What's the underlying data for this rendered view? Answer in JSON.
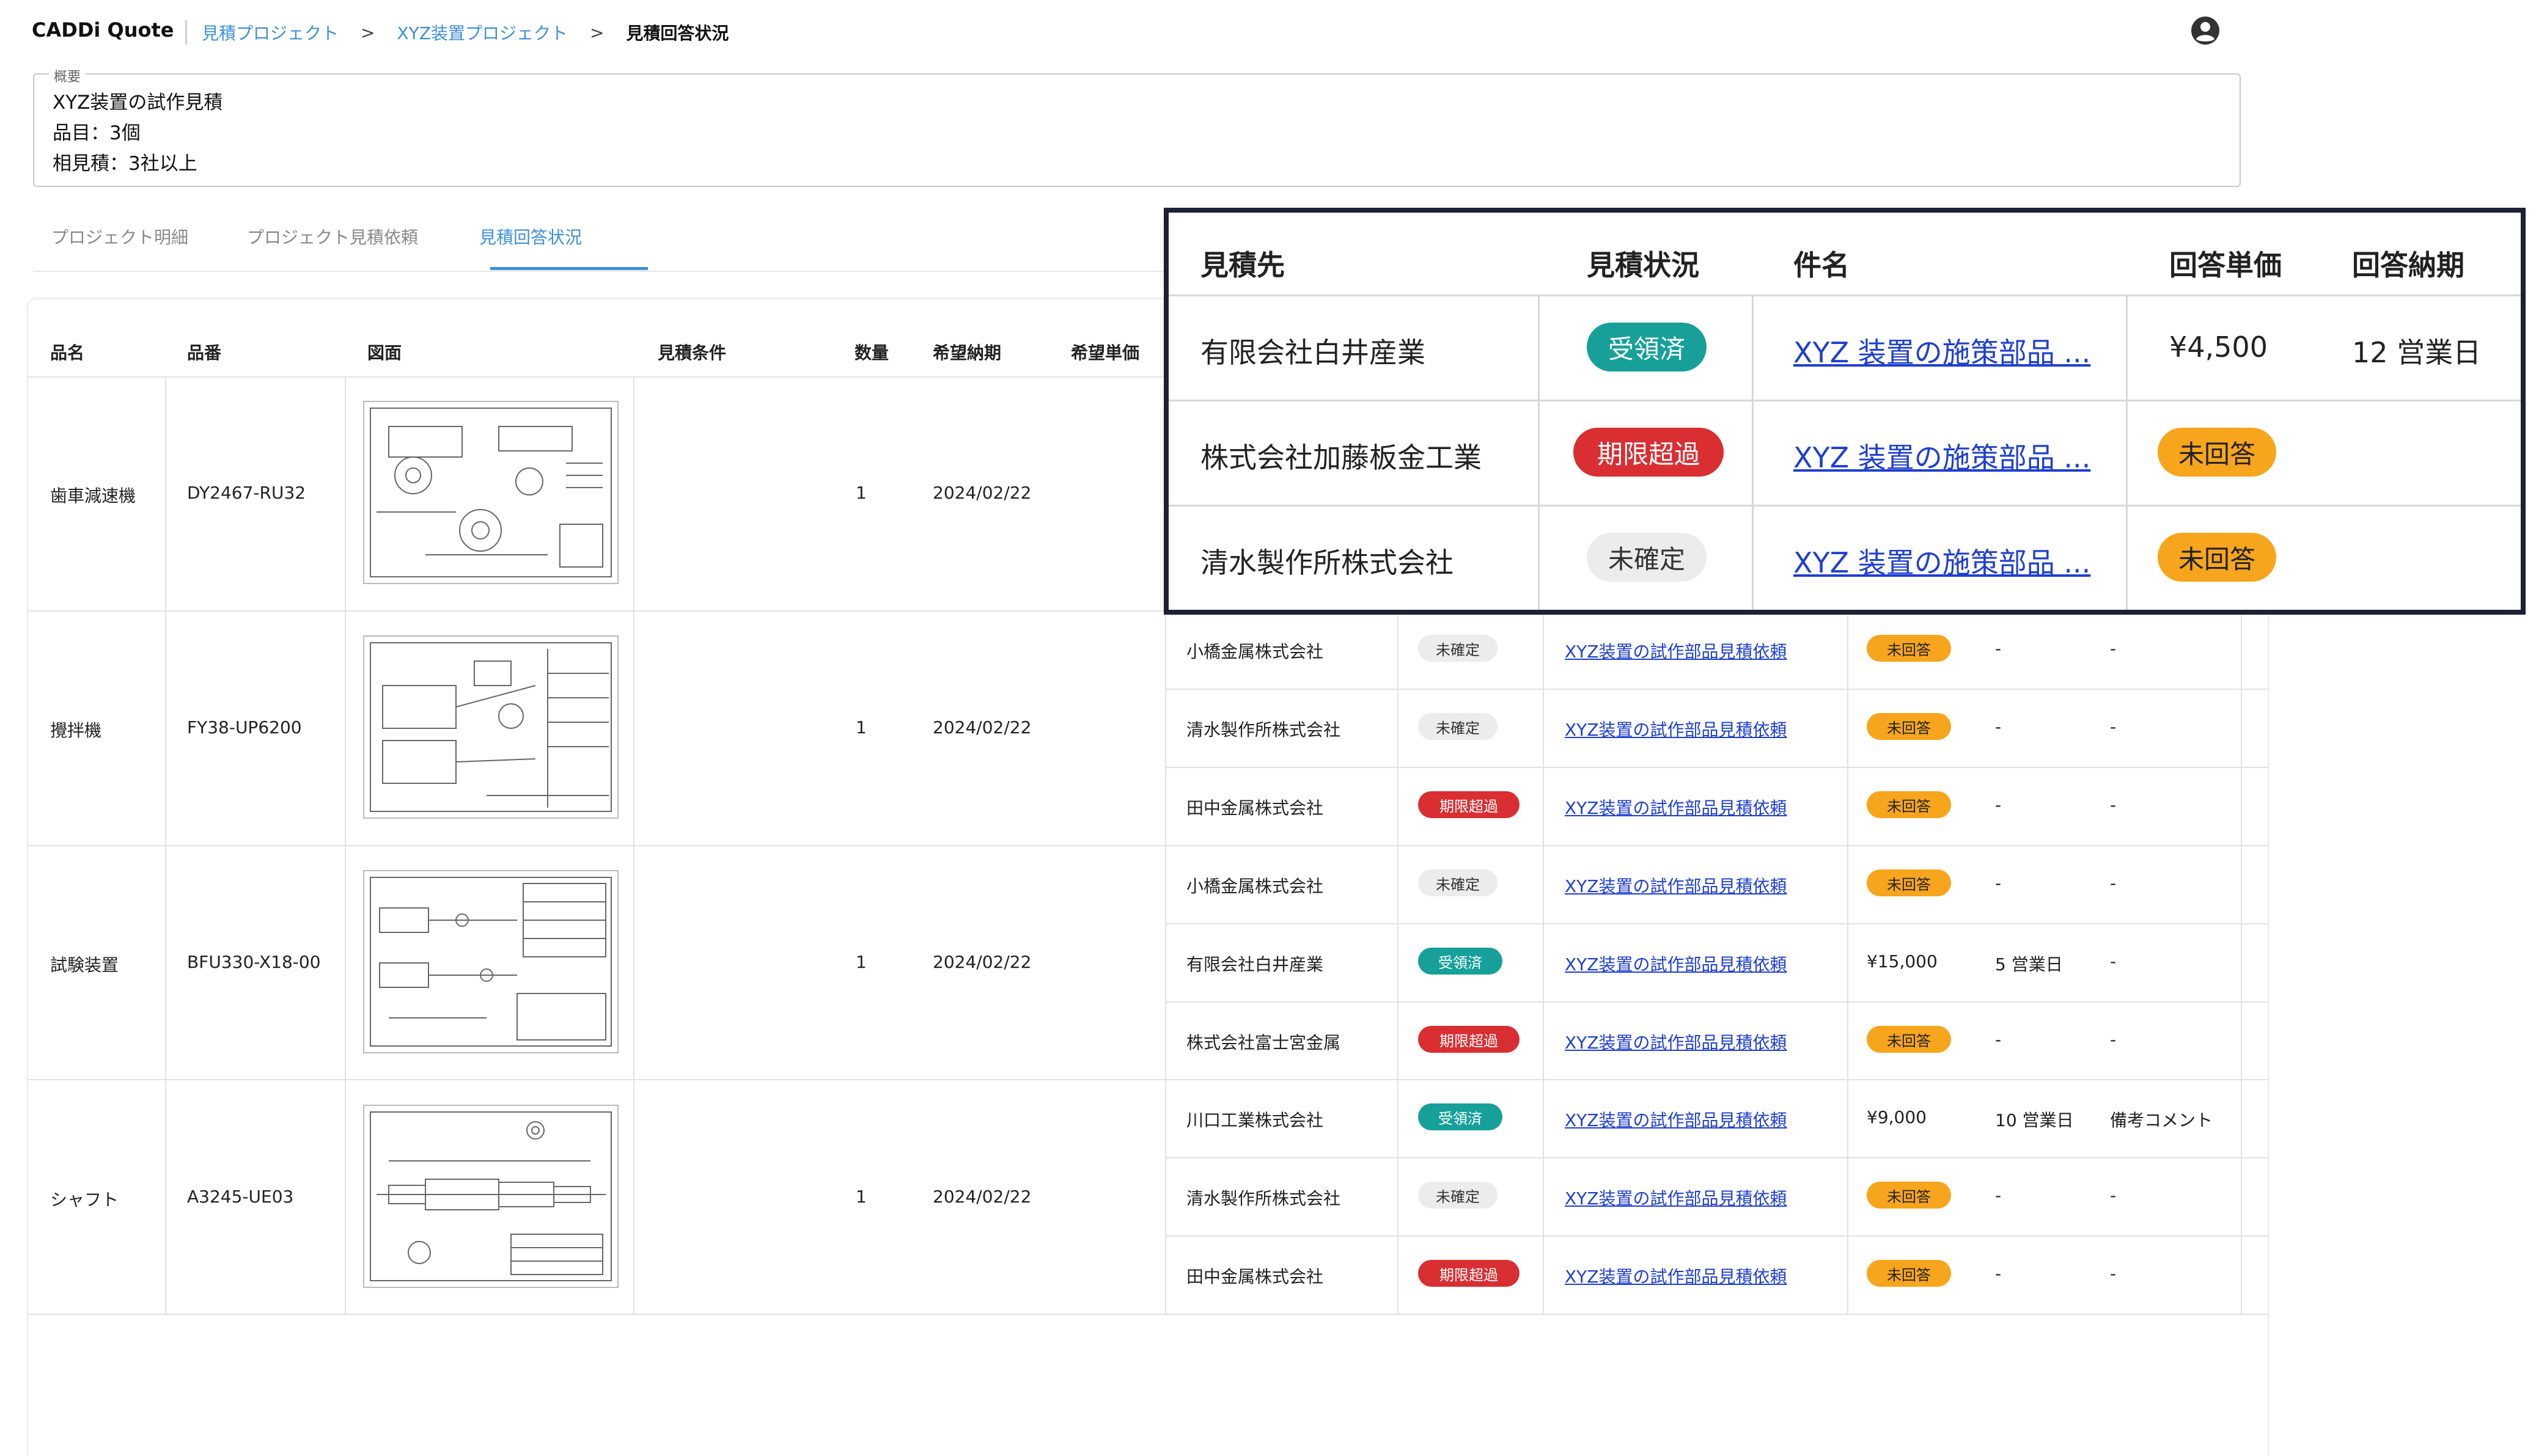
{
  "header": {
    "app_title": "CADDi Quote",
    "breadcrumbs": [
      "見積プロジェクト",
      "XYZ装置プロジェクト",
      "見積回答状況"
    ],
    "user_icon": "account-circle-icon"
  },
  "overview": {
    "legend": "概要",
    "lines": [
      "XYZ装置の試作見積",
      "品目：3個",
      "相見積：3社以上"
    ]
  },
  "tabs": [
    "プロジェクト明細",
    "プロジェクト見積依頼",
    "見積回答状況"
  ],
  "table": {
    "headers": [
      "品名",
      "品番",
      "図面",
      "見積条件",
      "数量",
      "希望納期",
      "希望単価"
    ],
    "items": [
      {
        "name": "歯車減速機",
        "number": "DY2467-RU32",
        "qty": "1",
        "due": "2024/02/22"
      },
      {
        "name": "攪拌機",
        "number": "FY38-UP6200",
        "qty": "1",
        "due": "2024/02/22"
      },
      {
        "name": "試験装置",
        "number": "BFU330-X18-00",
        "qty": "1",
        "due": "2024/02/22"
      },
      {
        "name": "シャフト",
        "number": "A3245-UE03",
        "qty": "1",
        "due": "2024/02/22"
      }
    ],
    "responses": [
      {
        "vendor": "小橋金属株式会社",
        "status": "未確定",
        "subject": "XYZ装置の試作部品見積依頼",
        "price_badge": "未回答",
        "lead": "-",
        "note": "-"
      },
      {
        "vendor": "清水製作所株式会社",
        "status": "未確定",
        "subject": "XYZ装置の試作部品見積依頼",
        "price_badge": "未回答",
        "lead": "-",
        "note": "-"
      },
      {
        "vendor": "田中金属株式会社",
        "status": "期限超過",
        "subject": "XYZ装置の試作部品見積依頼",
        "price_badge": "未回答",
        "lead": "-",
        "note": "-"
      },
      {
        "vendor": "小橋金属株式会社",
        "status": "未確定",
        "subject": "XYZ装置の試作部品見積依頼",
        "price_badge": "未回答",
        "lead": "-",
        "note": "-"
      },
      {
        "vendor": "有限会社白井産業",
        "status": "受領済",
        "subject": "XYZ装置の試作部品見積依頼",
        "price": "¥15,000",
        "lead": "5 営業日",
        "note": "-"
      },
      {
        "vendor": "株式会社富士宮金属",
        "status": "期限超過",
        "subject": "XYZ装置の試作部品見積依頼",
        "price_badge": "未回答",
        "lead": "-",
        "note": "-"
      },
      {
        "vendor": "川口工業株式会社",
        "status": "受領済",
        "subject": "XYZ装置の試作部品見積依頼",
        "price": "¥9,000",
        "lead": "10 営業日",
        "note": "備考コメント"
      },
      {
        "vendor": "清水製作所株式会社",
        "status": "未確定",
        "subject": "XYZ装置の試作部品見積依頼",
        "price_badge": "未回答",
        "lead": "-",
        "note": "-"
      },
      {
        "vendor": "田中金属株式会社",
        "status": "期限超過",
        "subject": "XYZ装置の試作部品見積依頼",
        "price_badge": "未回答",
        "lead": "-",
        "note": "-"
      }
    ]
  },
  "zoom": {
    "headers": [
      "見積先",
      "見積状況",
      "件名",
      "回答単価",
      "回答納期"
    ],
    "rows": [
      {
        "vendor": "有限会社白井産業",
        "status": "受領済",
        "subject": "XYZ 装置の施策部品 ...",
        "price": "¥4,500",
        "lead": "12 営業日"
      },
      {
        "vendor": "株式会社加藤板金工業",
        "status": "期限超過",
        "subject": "XYZ 装置の施策部品 ...",
        "price_badge": "未回答"
      },
      {
        "vendor": "清水製作所株式会社",
        "status": "未確定",
        "subject": "XYZ 装置の施策部品 ...",
        "price_badge": "未回答"
      }
    ]
  },
  "colors": {
    "accent": "#3d8fd9",
    "link": "#1f3fd1",
    "badge_pending": "#ececec",
    "badge_overdue": "#d92e32",
    "badge_received": "#16a099",
    "badge_noreply": "#f7a51c",
    "zoom_border": "#1c2233"
  }
}
